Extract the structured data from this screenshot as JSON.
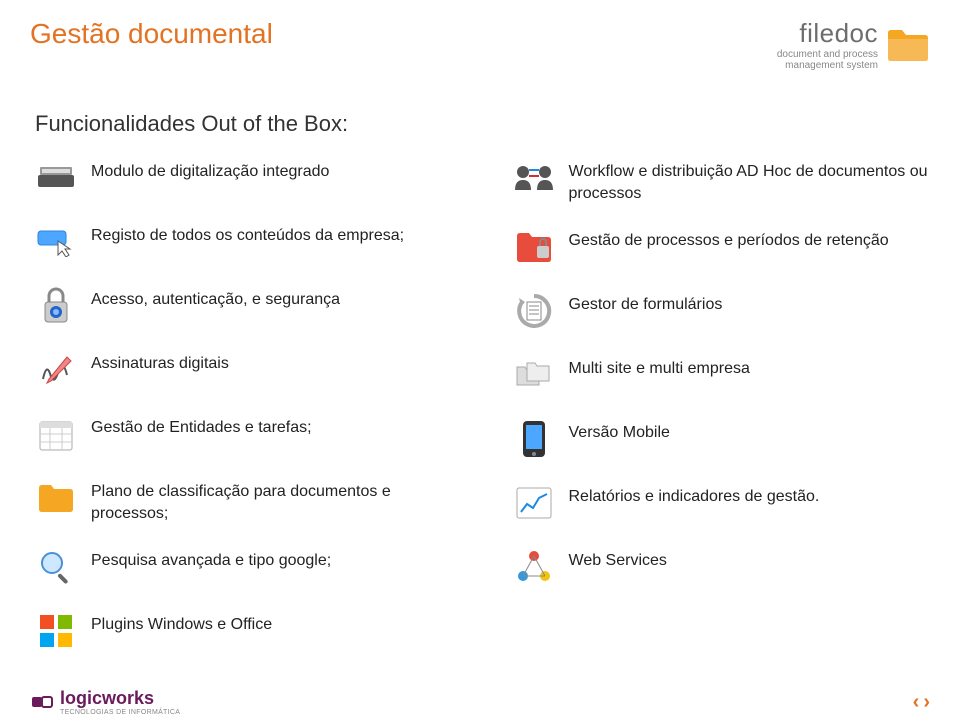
{
  "title": "Gestão documental",
  "logo": {
    "name": "filedoc",
    "tagline1": "document and process",
    "tagline2": "management system"
  },
  "subtitle": "Funcionalidades Out of the Box:",
  "left_features": [
    "Modulo de digitalização integrado",
    "Registo de todos os conteúdos da empresa;",
    "Acesso, autenticação, e segurança",
    "Assinaturas digitais",
    "Gestão de Entidades e tarefas;",
    "Plano de classificação para documentos e processos;",
    "Pesquisa avançada e tipo google;",
    "Plugins Windows e Office"
  ],
  "right_features": [
    "Workflow e distribuição AD Hoc de documentos ou processos",
    "Gestão de processos e períodos de retenção",
    "Gestor de formulários",
    "Multi site e multi empresa",
    "Versão Mobile",
    "Relatórios e indicadores de gestão.",
    "Web Services"
  ],
  "footer": {
    "company": "logicworks",
    "tagline": "TECNOLOGIAS DE INFORMÁTICA"
  },
  "nav": {
    "prev": "‹",
    "next": "›"
  }
}
